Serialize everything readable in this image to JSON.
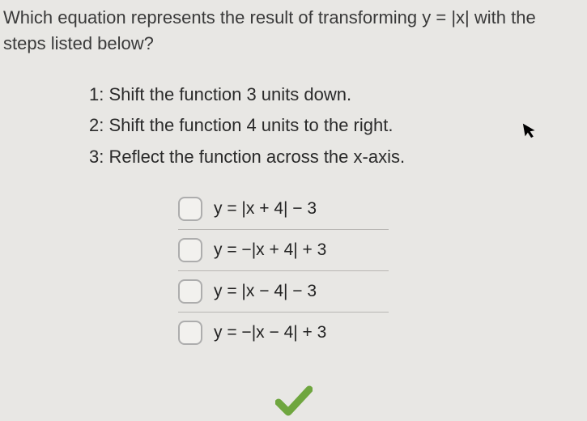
{
  "question": {
    "stem": "Which equation represents the result of transforming y = |x| with the steps listed below?",
    "steps": [
      "1:  Shift the function 3 units down.",
      "2:  Shift the function 4 units to the right.",
      "3:  Reflect the function across the x-axis."
    ],
    "options": [
      "y = |x + 4| − 3",
      "y = −|x + 4| + 3",
      "y = |x − 4| − 3",
      "y = −|x − 4| + 3"
    ]
  }
}
